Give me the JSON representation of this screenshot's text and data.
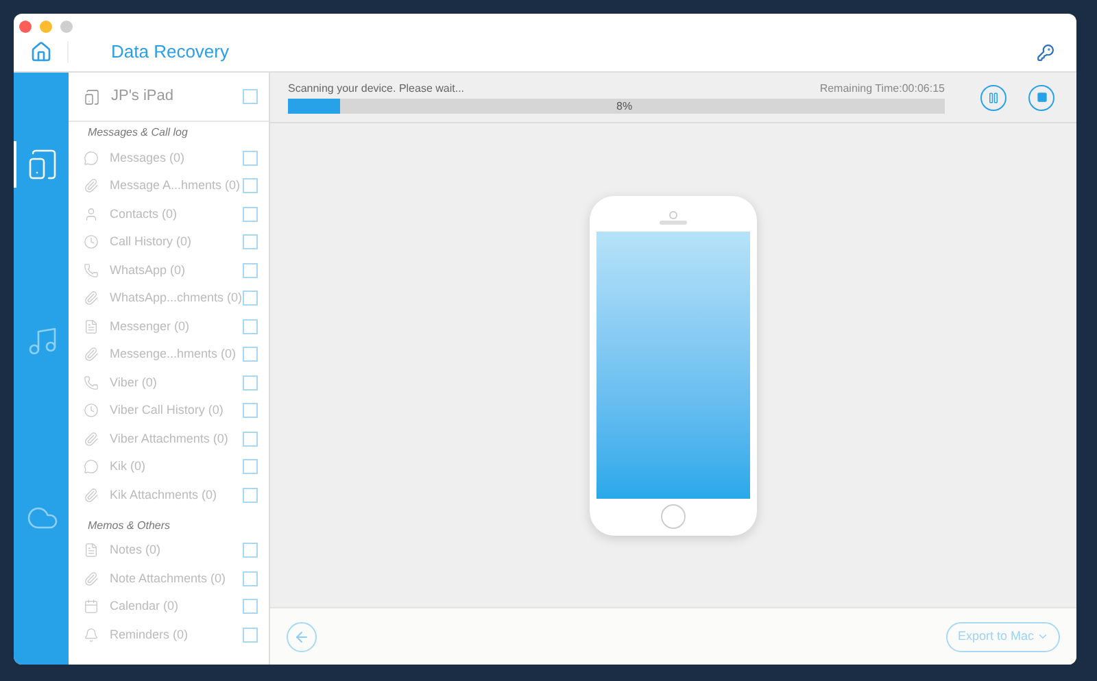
{
  "window": {
    "title": "Data Recovery"
  },
  "rail": [
    {
      "kind": "device",
      "selected": true
    },
    {
      "kind": "music",
      "selected": false
    },
    {
      "kind": "cloud",
      "selected": false
    }
  ],
  "device": {
    "name": "JP's iPad",
    "checked": false
  },
  "groups": [
    {
      "title": "Messages & Call log",
      "items": [
        {
          "label": "Messages (0)",
          "kind": "chat",
          "checked": false
        },
        {
          "label": "Message A...hments (0)",
          "kind": "clip",
          "checked": false
        },
        {
          "label": "Contacts (0)",
          "kind": "person",
          "checked": false
        },
        {
          "label": "Call History (0)",
          "kind": "clock",
          "checked": false
        },
        {
          "label": "WhatsApp (0)",
          "kind": "phone",
          "checked": false
        },
        {
          "label": "WhatsApp...chments (0)",
          "kind": "clip",
          "checked": false
        },
        {
          "label": "Messenger (0)",
          "kind": "doc",
          "checked": false
        },
        {
          "label": "Messenge...hments (0)",
          "kind": "clip",
          "checked": false
        },
        {
          "label": "Viber (0)",
          "kind": "phone",
          "checked": false
        },
        {
          "label": "Viber Call History (0)",
          "kind": "clock",
          "checked": false
        },
        {
          "label": "Viber Attachments (0)",
          "kind": "clip",
          "checked": false
        },
        {
          "label": "Kik (0)",
          "kind": "chat",
          "checked": false
        },
        {
          "label": "Kik Attachments (0)",
          "kind": "clip",
          "checked": false
        }
      ]
    },
    {
      "title": "Memos & Others",
      "items": [
        {
          "label": "Notes (0)",
          "kind": "doc",
          "checked": false
        },
        {
          "label": "Note Attachments (0)",
          "kind": "clip",
          "checked": false
        },
        {
          "label": "Calendar (0)",
          "kind": "calendar",
          "checked": false
        },
        {
          "label": "Reminders (0)",
          "kind": "bell",
          "checked": false
        }
      ]
    }
  ],
  "scan": {
    "status": "Scanning your device. Please wait...",
    "remaining": "Remaining Time:00:06:15",
    "level": 0.08,
    "percent": "8%"
  },
  "footer": {
    "export": "Export to Mac"
  }
}
